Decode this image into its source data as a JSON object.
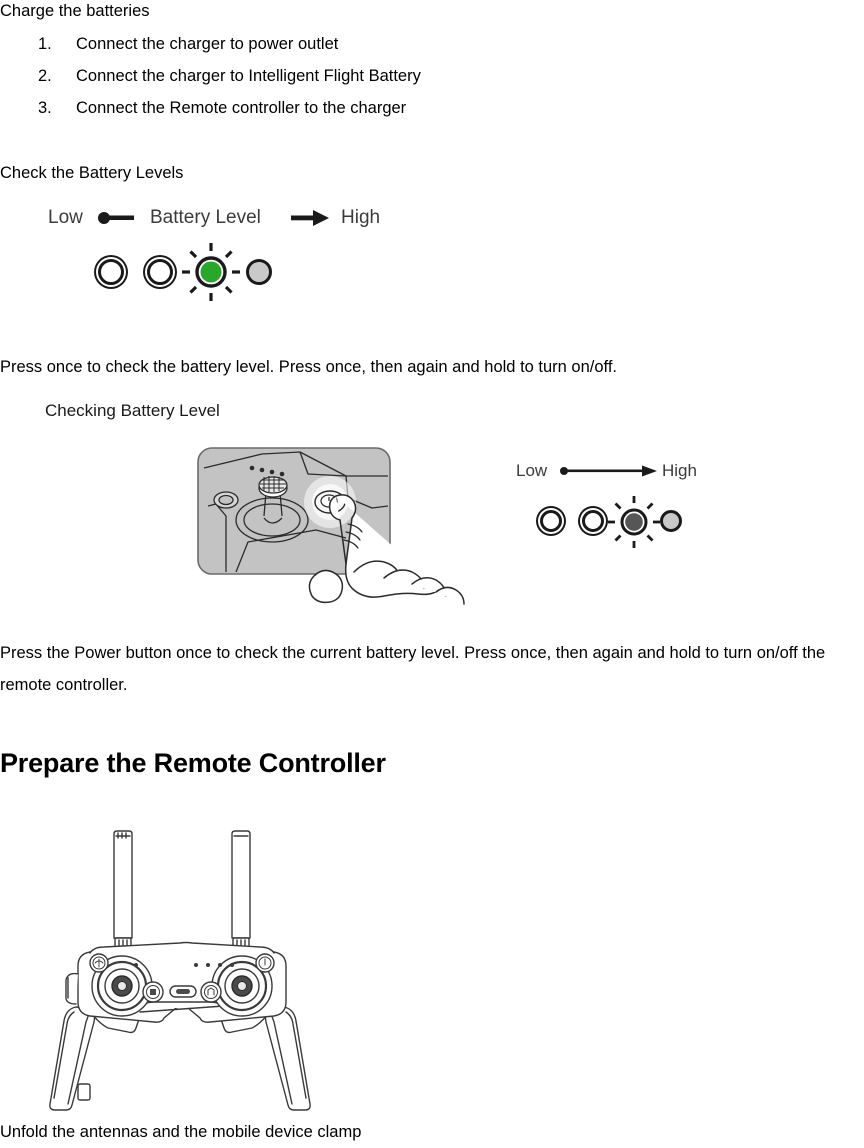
{
  "document": {
    "section_charge": {
      "heading": "Charge the batteries",
      "steps": [
        {
          "number": "1.",
          "label": "Connect the charger to power outlet"
        },
        {
          "number": "2.",
          "label": "Connect the charger to Intelligent Flight Battery"
        },
        {
          "number": "3.",
          "label": "Connect the Remote controller to the charger"
        }
      ]
    },
    "section_battery_levels": {
      "heading": "Check the Battery Levels",
      "diagram": {
        "low_label": "Low",
        "title_label": "Battery Level",
        "high_label": "High",
        "led_states": [
          "empty",
          "empty",
          "active",
          "dim"
        ],
        "active_color": "#2aa62a",
        "dim_color": "#c9c9c9"
      },
      "body": "Press once to check the battery level. Press once, then again and hold to turn on/off."
    },
    "section_checking": {
      "caption": "Checking Battery Level",
      "diagram": {
        "low_label": "Low",
        "high_label": "High",
        "led_states": [
          "empty",
          "empty",
          "active",
          "dim"
        ],
        "active_color": "#565656",
        "dim_color": "#c9c9c9"
      },
      "body": "Press the Power button once to check the current battery level. Press once, then again and hold to turn on/off the remote controller."
    },
    "section_prepare": {
      "heading": "Prepare the Remote Controller",
      "body": "Unfold the antennas and the mobile device clamp"
    }
  }
}
